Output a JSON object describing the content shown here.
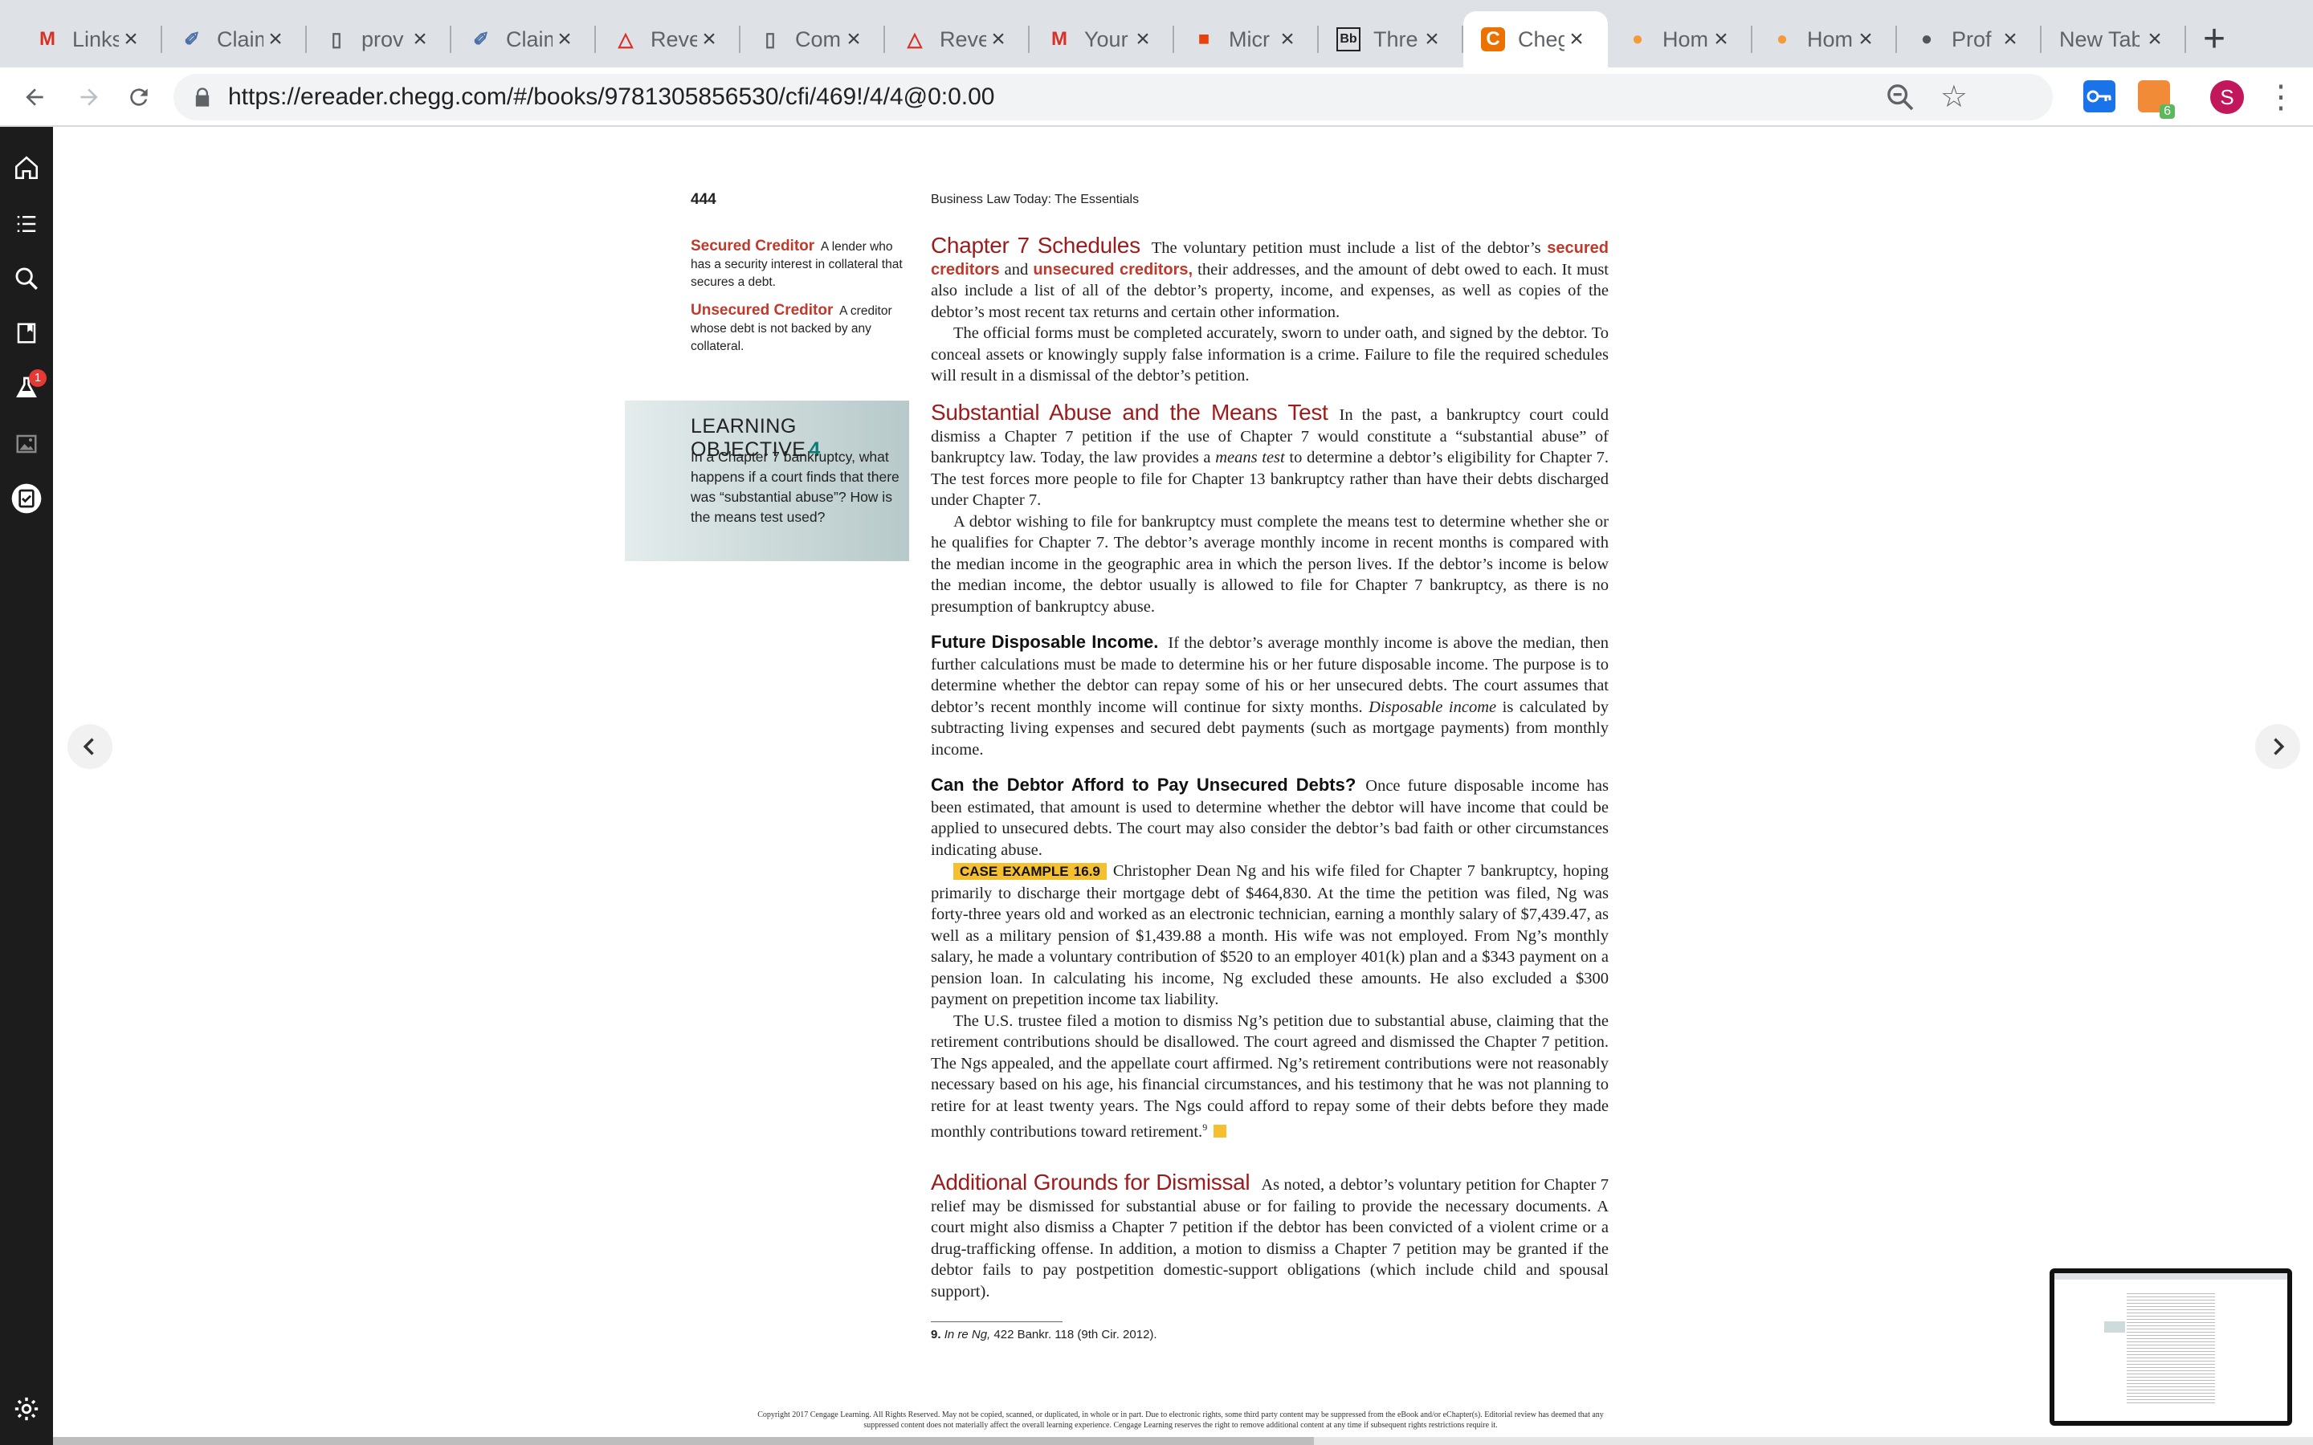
{
  "browser": {
    "tabs": [
      {
        "title": "Links",
        "icon": "gmail-icon"
      },
      {
        "title": "Claim",
        "icon": "link-icon"
      },
      {
        "title": "prov",
        "icon": "document-icon"
      },
      {
        "title": "Claim",
        "icon": "link-icon"
      },
      {
        "title": "Reve",
        "icon": "warning-triangle-icon"
      },
      {
        "title": "Com",
        "icon": "document-icon"
      },
      {
        "title": "Reve",
        "icon": "warning-triangle-icon"
      },
      {
        "title": "Your",
        "icon": "gmail-icon"
      },
      {
        "title": "Micr",
        "icon": "office-icon"
      },
      {
        "title": "Thre",
        "icon": "blackboard-icon"
      },
      {
        "title": "Cheg",
        "icon": "chegg-icon",
        "active": true
      },
      {
        "title": "Hom",
        "icon": "orange-circle-icon"
      },
      {
        "title": "Hom",
        "icon": "orange-circle-icon"
      },
      {
        "title": "Prof",
        "icon": "apple-icon"
      },
      {
        "title": "New Tab",
        "icon": ""
      }
    ],
    "url": "https://ereader.chegg.com/#/books/9781305856530/cfi/469!/4/4@0:0.00",
    "avatar_letter": "S",
    "extension_badge": "6"
  },
  "sidebar": {
    "items": [
      "home-icon",
      "contents-list-icon",
      "search-icon",
      "bookmark-icon",
      "flask-icon",
      "image-icon",
      "checklist-icon"
    ],
    "flask_badge": "1",
    "settings": "gear-icon"
  },
  "page": {
    "number": "444",
    "running_head": "Business Law Today: The Essentials",
    "glossary": [
      {
        "term": "Secured Creditor",
        "definition": "A lender who has a security interest in collateral that secures a debt."
      },
      {
        "term": "Unsecured Creditor",
        "definition": "A creditor whose debt is not backed by any collateral."
      }
    ],
    "learning_objective": {
      "label": "LEARNING OBJECTIVE",
      "number": "4",
      "text": "In a Chapter 7 bankruptcy, what happens if a court finds that there was “substantial abuse”? How is the means test used?"
    },
    "s1": {
      "heading": "Chapter 7 Schedules",
      "t1": "The voluntary petition must include a list of the debtor’s ",
      "kw1": "secured creditors",
      "t2": " and ",
      "kw2": "unsecured creditors,",
      "t3": " their addresses, and the amount of debt owed to each. It must also include a list of all of the debtor’s property, income, and expenses, as well as copies of the debtor’s most recent tax returns and certain other information.",
      "p2": "The official forms must be completed accurately, sworn to under oath, and signed by the debtor. To conceal assets or knowingly supply false information is a crime. Failure to file the required schedules will result in a dismissal of the debtor’s petition."
    },
    "s2": {
      "heading": "Substantial Abuse and the Means Test",
      "t1": "In the past, a bankruptcy court could dismiss a Chapter 7 petition if the use of Chapter 7 would constitute a “substantial abuse” of bankruptcy law. Today, the law provides a ",
      "em": "means test",
      "t2": " to determine a debtor’s eligibility for Chapter 7. The test forces more people to file for Chapter 13 bankruptcy rather than have their debts discharged under Chapter 7.",
      "p2": "A debtor wishing to file for bankruptcy must complete the means test to determine whether she or he qualifies for Chapter 7. The debtor’s average monthly income in recent months is compared with the median income in the geographic area in which the person lives. If the debtor’s income is below the median income, the debtor usually is allowed to file for Chapter 7 bankruptcy, as there is no presumption of bankruptcy abuse."
    },
    "s3": {
      "heading": "Future Disposable Income.",
      "t1": "If the debtor’s average monthly income is above the median, then further calculations must be made to determine his or her future disposable income. The purpose is to determine whether the debtor can repay some of his or her unsecured debts. The court assumes that debtor’s recent monthly income will continue for sixty months. ",
      "em": "Disposable income",
      "t2": " is calculated by subtracting living expenses and secured debt payments (such as mortgage payments) from monthly income."
    },
    "s4": {
      "heading": "Can the Debtor Afford to Pay Unsecured Debts?",
      "t1": "Once future disposable income has been estimated, that amount is used to determine whether the debtor will have income that could be applied to unsecured debts. The court may also consider the debtor’s bad faith or other circumstances indicating abuse.",
      "case_label": "CASE EXAMPLE 16.9",
      "case_text": "Christopher Dean Ng and his wife filed for Chapter 7 bankruptcy, hoping primarily to discharge their mortgage debt of $464,830. At the time the petition was filed, Ng was forty-three years old and worked as an electronic technician, earning a monthly salary of $7,439.47, as well as a military pension of $1,439.88 a month. His wife was not employed. From Ng’s monthly salary, he made a voluntary contribution of $520 to an employer 401(k) plan and a $343 payment on a pension loan. In calculating his income, Ng excluded these amounts. He also excluded a $300 payment on prepetition income tax liability.",
      "p3": "The U.S. trustee filed a motion to dismiss Ng’s petition due to substantial abuse, claiming that the retirement contributions should be disallowed. The court agreed and dismissed the Chapter 7 petition. The Ngs appealed, and the appellate court affirmed. Ng’s retirement contributions were not reasonably necessary based on his age, his financial circumstances, and his testimony that he was not planning to retire for at least twenty years. The Ngs could afford to repay some of their debts before they made monthly contributions toward retirement.",
      "fn_ref": "9"
    },
    "s5": {
      "heading": "Additional Grounds for Dismissal",
      "t1": "As noted, a debtor’s voluntary petition for Chapter 7 relief may be dismissed for substantial abuse or for failing to provide the necessary documents. A court might also dismiss a Chapter 7 petition if the debtor has been convicted of a violent crime or a drug-trafficking offense. In addition, a motion to dismiss a Chapter 7 petition may be granted if the debtor fails to pay postpetition domestic-support obligations (which include child and spousal support)."
    },
    "footnote": {
      "num": "9.",
      "case": "In re Ng,",
      "cite": " 422 Bankr. 118 (9th Cir. 2012)."
    },
    "copyright": "Copyright 2017 Cengage Learning. All Rights Reserved. May not be copied, scanned, or duplicated, in whole or in part. Due to electronic rights, some third party content may be suppressed from the eBook and/or eChapter(s). Editorial review has deemed that any suppressed content does not materially affect the overall learning experience. Cengage Learning reserves the right to remove additional content at any time if subsequent rights restrictions require it."
  },
  "colors": {
    "accent_red": "#c0392b",
    "heading_red": "#9b1c1c",
    "case_yellow": "#f5c02f",
    "lo_teal": "#0f7b78"
  }
}
